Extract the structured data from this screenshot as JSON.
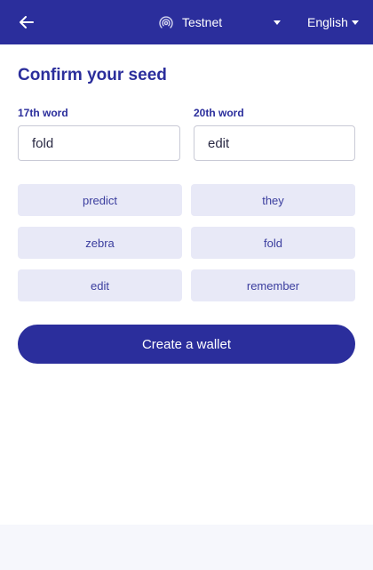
{
  "header": {
    "back_icon": "arrow-left-icon",
    "network": {
      "icon": "signal-broadcast-icon",
      "label": "Testnet"
    },
    "language": {
      "label": "English"
    }
  },
  "main": {
    "title": "Confirm your seed",
    "fields": [
      {
        "label": "17th word",
        "value": "fold"
      },
      {
        "label": "20th word",
        "value": "edit"
      }
    ],
    "words": [
      "predict",
      "they",
      "zebra",
      "fold",
      "edit",
      "remember"
    ],
    "create_button": "Create a wallet"
  },
  "colors": {
    "primary": "#2b2e9c",
    "chip_bg": "#e8e9f7",
    "footer_bg": "#f6f7fc"
  }
}
